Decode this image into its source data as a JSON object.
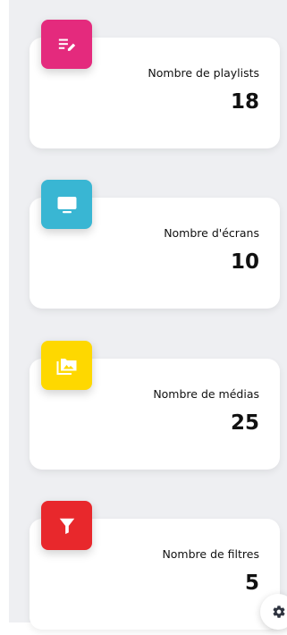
{
  "colors": {
    "background": "#eeeff2",
    "card": "#ffffff",
    "playlists": "#e42a7d",
    "screens": "#39b6d3",
    "media": "#fed800",
    "filters": "#e8282c"
  },
  "stats": [
    {
      "title": "Nombre de playlists",
      "value": "18",
      "icon": "playlist-edit-icon",
      "color_key": "playlists"
    },
    {
      "title": "Nombre d'écrans",
      "value": "10",
      "icon": "monitor-icon",
      "color_key": "screens"
    },
    {
      "title": "Nombre de médias",
      "value": "25",
      "icon": "image-folder-icon",
      "color_key": "media"
    },
    {
      "title": "Nombre de filtres",
      "value": "5",
      "icon": "filter-icon",
      "color_key": "filters"
    }
  ],
  "settings": {
    "icon": "gear-icon"
  }
}
